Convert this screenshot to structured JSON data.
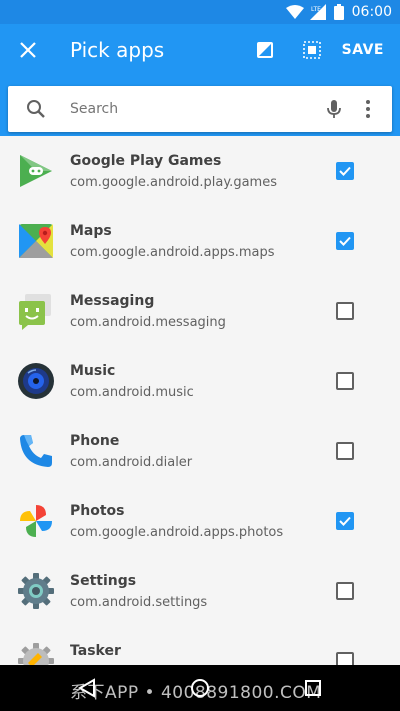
{
  "status_bar": {
    "time": "06:00",
    "network": "LTE"
  },
  "toolbar": {
    "title": "Pick apps",
    "save_label": "SAVE"
  },
  "search": {
    "placeholder": "Search",
    "value": ""
  },
  "apps": [
    {
      "name": "Google Play Games",
      "package": "com.google.android.play.games",
      "checked": true
    },
    {
      "name": "Maps",
      "package": "com.google.android.apps.maps",
      "checked": true
    },
    {
      "name": "Messaging",
      "package": "com.android.messaging",
      "checked": false
    },
    {
      "name": "Music",
      "package": "com.android.music",
      "checked": false
    },
    {
      "name": "Phone",
      "package": "com.android.dialer",
      "checked": false
    },
    {
      "name": "Photos",
      "package": "com.google.android.apps.photos",
      "checked": true
    },
    {
      "name": "Settings",
      "package": "com.android.settings",
      "checked": false
    },
    {
      "name": "Tasker",
      "package": "",
      "checked": false
    }
  ],
  "watermark": "系下APP • 4008891800.COM",
  "colors": {
    "primary": "#2196f3",
    "status": "#1e88e5",
    "check": "#2196f3"
  }
}
